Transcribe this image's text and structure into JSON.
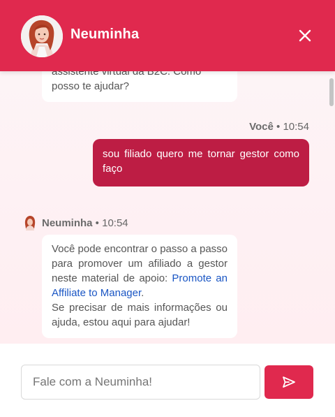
{
  "header": {
    "title": "Neuminha",
    "avatar_icon": "neuminha-avatar-icon",
    "close_icon": "close-icon",
    "color": "#e0294e"
  },
  "messages": {
    "first_bot": {
      "line1": "assistente virtual da B2C. Como",
      "line2": "posso te ajudar?"
    },
    "user": {
      "author": "Você",
      "time": "10:54",
      "text": "sou filiado quero me tornar gestor como faço",
      "color": "#bd1d44"
    },
    "bot": {
      "author": "Neuminha",
      "time": "10:54",
      "text_before_link": "Você pode encontrar o passo a passo para promover um afiliado a gestor neste material de apoio: ",
      "link_text": "Promote an Affiliate to Manager",
      "text_after_link": ".",
      "text_followup": "Se precisar de mais informações ou ajuda, estou aqui para ajudar!"
    }
  },
  "composer": {
    "placeholder": "Fale com a Neuminha!",
    "send_icon": "send-icon"
  }
}
